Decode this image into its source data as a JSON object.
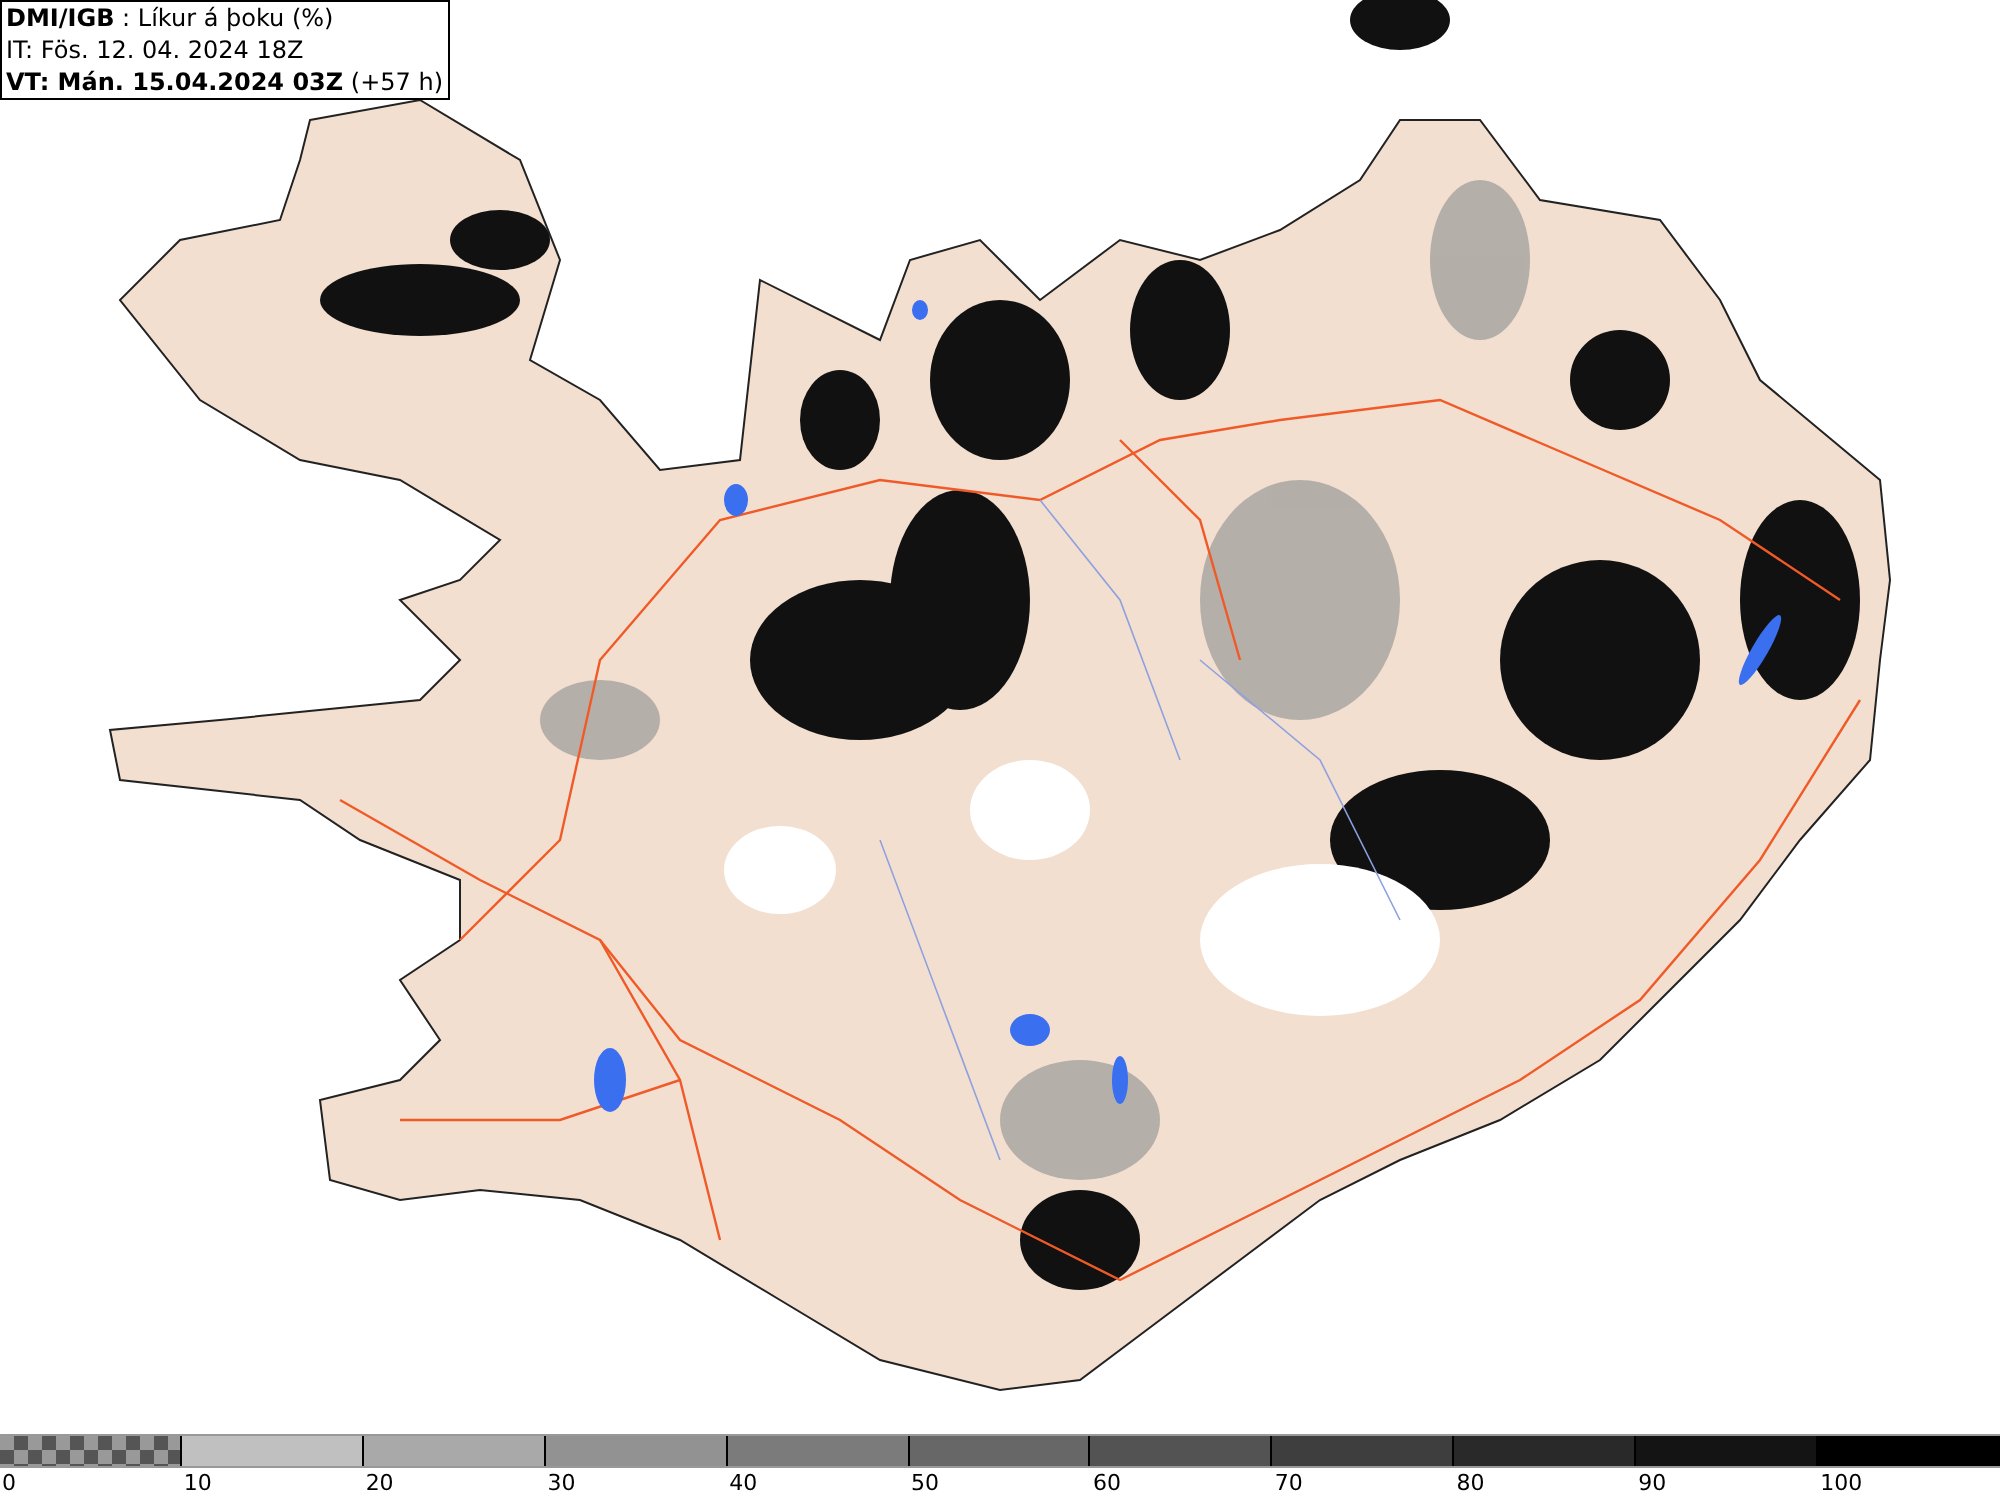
{
  "header": {
    "title": "**DMI/IGB** : Líkur á þoku (%)",
    "issue_time": "IT: Fös. 12. 04. 2024 18Z",
    "valid_time": "**VT: Mán. 15.04.2024 03Z** (+57 h)"
  },
  "legend": {
    "segments": [
      {
        "kind": "checker"
      },
      {
        "kind": "solid",
        "color": "#c0c0c0"
      },
      {
        "kind": "solid",
        "color": "#a9a9a9"
      },
      {
        "kind": "solid",
        "color": "#929292"
      },
      {
        "kind": "solid",
        "color": "#7b7b7b"
      },
      {
        "kind": "solid",
        "color": "#676767"
      },
      {
        "kind": "solid",
        "color": "#535353"
      },
      {
        "kind": "solid",
        "color": "#3e3e3e"
      },
      {
        "kind": "solid",
        "color": "#292929"
      },
      {
        "kind": "solid",
        "color": "#141414"
      },
      {
        "kind": "solid",
        "color": "#000000"
      }
    ],
    "labels": [
      "0",
      "10",
      "20",
      "30",
      "40",
      "50",
      "60",
      "70",
      "80",
      "90",
      "100"
    ]
  }
}
